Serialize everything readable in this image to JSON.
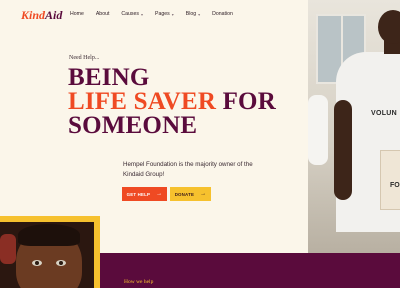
{
  "header": {
    "logo_part1": "Kind",
    "logo_part2": "Aid",
    "nav": [
      {
        "label": "Home",
        "dropdown": false
      },
      {
        "label": "About",
        "dropdown": false
      },
      {
        "label": "Causes",
        "dropdown": true
      },
      {
        "label": "Pages",
        "dropdown": true
      },
      {
        "label": "Blog",
        "dropdown": true
      },
      {
        "label": "Donation",
        "dropdown": false
      }
    ]
  },
  "hero": {
    "tagline": "Need Help...",
    "headline_line1": "BEING",
    "headline_accent": "LIFE SAVER",
    "headline_line2_rest": "FOR",
    "headline_line3": "SOMEONE",
    "description": "Hempel Foundation is the majority owner of the Kindaid Group!",
    "photo_shirt_text": "VOLUN",
    "photo_box_text": "FO",
    "buttons": {
      "help_label": "GET HELP",
      "donate_label": "DONATE",
      "arrow": "→"
    }
  },
  "section": {
    "label": "How we help"
  },
  "colors": {
    "brand_plum": "#5a0b3c",
    "brand_orange": "#ef4a23",
    "brand_yellow": "#f6c12e",
    "background": "#fbf6ea"
  }
}
